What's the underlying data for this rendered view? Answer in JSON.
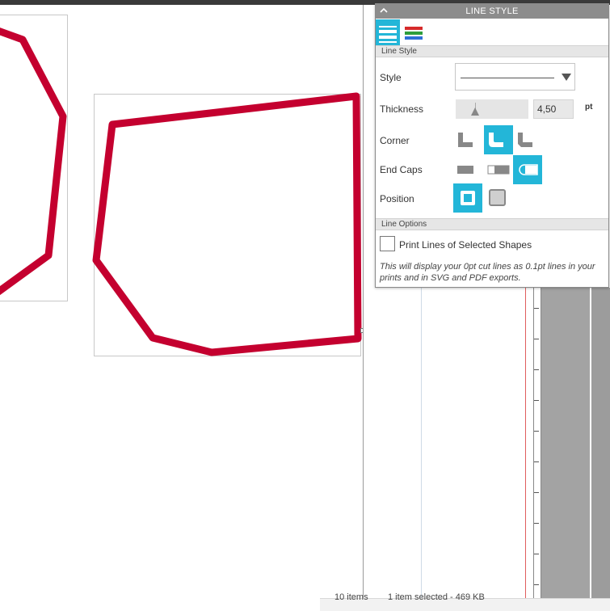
{
  "panel": {
    "title": "LINE STYLE",
    "tabs": [
      {
        "name": "line-style-tab",
        "active": true
      },
      {
        "name": "line-color-tab",
        "active": false
      }
    ],
    "section_line_style": "Line Style",
    "style_label": "Style",
    "thickness_label": "Thickness",
    "thickness_value": "4,50",
    "thickness_unit": "pt",
    "corner_label": "Corner",
    "corner_options": [
      "sharp",
      "rounded",
      "bevel"
    ],
    "corner_selected": "rounded",
    "endcaps_label": "End Caps",
    "endcaps_options": [
      "butt",
      "square",
      "round"
    ],
    "endcaps_selected": "round",
    "position_label": "Position",
    "position_options": [
      "center",
      "inside"
    ],
    "position_selected": "center",
    "section_line_options": "Line Options",
    "print_lines_label": "Print Lines of Selected Shapes",
    "print_lines_checked": false,
    "note": "This will display your 0pt cut lines as 0.1pt lines in your prints and in SVG and PDF exports."
  },
  "status_bar": {
    "items_count": "10 items",
    "selection_info": "1 item selected - 469 KB"
  },
  "colors": {
    "accent": "#23b6d8",
    "shape_stroke": "#c4002f",
    "panel_header": "#8c8c8c"
  }
}
